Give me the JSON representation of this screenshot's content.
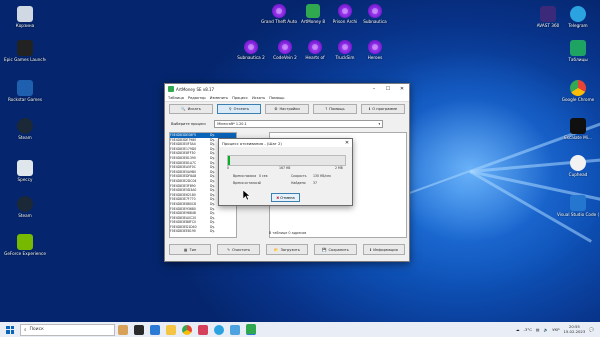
{
  "desktop": {
    "left_icons": [
      {
        "label": "Корзина",
        "color": "#cfd8e3"
      },
      {
        "label": "Epic Games Launcher",
        "color": "#222222"
      },
      {
        "label": "Rockstar Games",
        "color": "#1f5fb0"
      },
      {
        "label": "Steam",
        "color": "#1b2838"
      },
      {
        "label": "Speccy",
        "color": "#dfe6ec"
      },
      {
        "label": "Steam",
        "color": "#1b2838"
      },
      {
        "label": "GeForce Experience",
        "color": "#76b900"
      }
    ],
    "torrent_row1": [
      "Grand Theft Auto",
      "ArtMoney 8",
      "Prison Archi",
      "Subnautica"
    ],
    "torrent_row2": [
      "Subnautica 2",
      "CodeVein 2",
      "Hearts of",
      "TruckSim",
      "Heroes"
    ],
    "right_icons": [
      {
        "label": "AVAST 360",
        "color": "#3b2a7a"
      },
      {
        "label": "Telegram",
        "color": "#2aa3e0"
      },
      {
        "label": "Таблицы",
        "color": "#1ea362"
      },
      {
        "label": "Google Chrome",
        "color": "#e94335"
      },
      {
        "label": "Escalate Mi...",
        "color": "#101010"
      },
      {
        "label": "Cuphead",
        "color": "#f2f2f2"
      },
      {
        "label": "Visual Studio Code (2)",
        "color": "#2576cf"
      }
    ]
  },
  "window": {
    "title": "ArtMoney SE v8.17",
    "controls": [
      "–",
      "☐",
      "✕"
    ],
    "menu": [
      "Таблица",
      "Редактор",
      "Изменить",
      "Процесс",
      "Искать",
      "Помощь"
    ],
    "toolbar": [
      {
        "label": "Искать",
        "icon": "search-icon"
      },
      {
        "label": "Отсеять",
        "icon": "filter-icon"
      },
      {
        "label": "Настройки",
        "icon": "settings-icon"
      },
      {
        "label": "Помощь",
        "icon": "help-icon"
      },
      {
        "label": "О программе",
        "icon": "info-icon"
      }
    ],
    "process_label": "Выберите процесс",
    "process_value": "Minecraft* 1.20.1",
    "rows": [
      {
        "addr": "F0E4D83DE08F5",
        "type": "Dy.",
        "sel": true
      },
      {
        "addr": "F0E4D83DE7980",
        "type": "Dy."
      },
      {
        "addr": "F0E4D83E0F5A4",
        "type": "Dy."
      },
      {
        "addr": "F0E4D83E179D0",
        "type": "Dy."
      },
      {
        "addr": "F0E4D83E8FF30",
        "type": "Dy."
      },
      {
        "addr": "F0E4D83E81390",
        "type": "Dy."
      },
      {
        "addr": "F0E4D83E81A7C",
        "type": "Dy."
      },
      {
        "addr": "F0E4D83EA5F0C",
        "type": "Dy."
      },
      {
        "addr": "F0E4D83E0A9B0",
        "type": "Dy."
      },
      {
        "addr": "F0E4D83EDF8A8",
        "type": "Dy."
      },
      {
        "addr": "F0E4D83E2DC04",
        "type": "Dy."
      },
      {
        "addr": "F0E4D83E3F890",
        "type": "Dy."
      },
      {
        "addr": "F0E4D83E5D3A0",
        "type": "Dy."
      },
      {
        "addr": "F0E4D83E62180",
        "type": "Dy."
      },
      {
        "addr": "F0E4D83E7F770",
        "type": "Dy."
      },
      {
        "addr": "F0E4D83E880C8",
        "type": "Dy."
      },
      {
        "addr": "F0E4D83E93680",
        "type": "Dy."
      },
      {
        "addr": "F0E4D83E98848",
        "type": "Dy."
      },
      {
        "addr": "F0E4D83EA0C20",
        "type": "Dy."
      },
      {
        "addr": "F0E4D83EB8FC0",
        "type": "Dy."
      },
      {
        "addr": "F0E4D83ED1D40",
        "type": "Dy."
      },
      {
        "addr": "F0E4D83EE8190",
        "type": "Dy."
      }
    ],
    "status": "В таблице 0 адресов",
    "bottom_buttons": [
      {
        "label": "Тип",
        "icon": "type-icon"
      },
      {
        "label": "Очистить",
        "icon": "clear-icon"
      },
      {
        "label": "Загрузить",
        "icon": "load-icon"
      },
      {
        "label": "Сохранить",
        "icon": "save-icon"
      },
      {
        "label": "Информация",
        "icon": "info-icon"
      }
    ]
  },
  "dialog": {
    "title": "Процесс отсеивания - (Шаг 2)",
    "close": "✕",
    "progress_fraction": 0.02,
    "start": "0",
    "mid": "167 Кб",
    "end": "2 Мб",
    "left_labels": [
      "Время поиска",
      "Время осталось"
    ],
    "left_values": [
      "0 сек",
      "0"
    ],
    "right_labels": [
      "Скорость",
      "Найдено"
    ],
    "right_values": [
      "130 Кб/сек",
      "37"
    ],
    "stop_label": "Отмена"
  },
  "taskbar": {
    "search_placeholder": "Поиск",
    "tray_temp": "-3°C",
    "lang": "УКР",
    "time": "20:55",
    "date": "15.02.2023"
  },
  "colors": {
    "accent": "#0a64b8",
    "progress": "#06b025"
  }
}
